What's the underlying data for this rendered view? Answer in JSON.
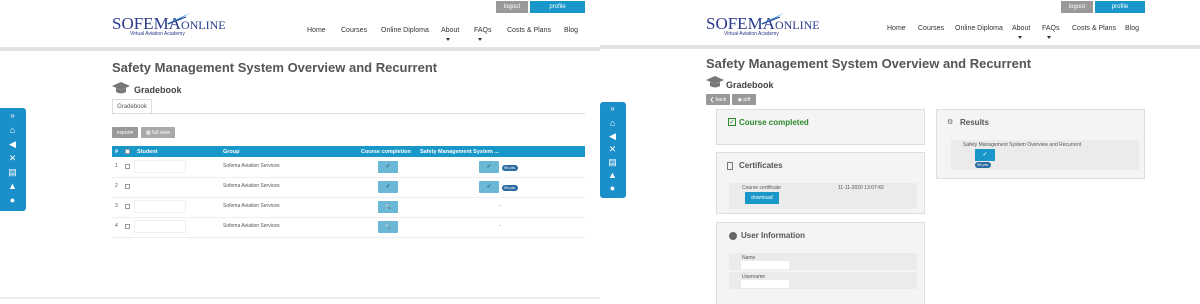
{
  "topbar": {
    "logout": "logout",
    "profile": "profile"
  },
  "logo": {
    "brand_a": "SOFEMA",
    "brand_b": "ONLINE",
    "tagline": "Virtual Aviation Academy"
  },
  "nav": [
    "Home",
    "Courses",
    "Online Diploma",
    "About",
    "FAQs",
    "Costs & Plans",
    "Blog"
  ],
  "page_title": "Safety Management System Overview and Recurrent",
  "gradebook_label": "Gradebook",
  "left": {
    "tab_gradebook": "Gradebook",
    "export_label": "export",
    "full_view_label": "full view",
    "columns": [
      "#",
      "Student",
      "Group",
      "Course completion",
      "Safety Management System ..."
    ],
    "rows": [
      {
        "num": "1",
        "group": "Sofema Aviation Services",
        "course_icon": "✓",
        "sms_icon": "✓",
        "sms_badge": "98 pts."
      },
      {
        "num": "2",
        "group": "Sofema Aviation Services",
        "course_icon": "✓",
        "sms_icon": "✓",
        "sms_badge": "98 pts."
      },
      {
        "num": "3",
        "group": "Sofema Aviation Services",
        "course_icon": "🔍",
        "sms_dash": "-"
      },
      {
        "num": "4",
        "group": "Sofema Aviation Services",
        "course_icon": "🔍",
        "sms_dash": "-"
      }
    ]
  },
  "right": {
    "back_label": "back",
    "pdf_label": "pdf",
    "course_completed": "Course completed",
    "certificates_title": "Certificates",
    "cert_name": "Course certificate",
    "cert_date": "11-11-2020 13:07:43",
    "download_label": "download",
    "user_info_title": "User Information",
    "name_label": "Name",
    "username_label": "Username",
    "results_title": "Results",
    "result_name": "Safety Management System Overview and Recurrent",
    "result_badge": "98 pts."
  }
}
